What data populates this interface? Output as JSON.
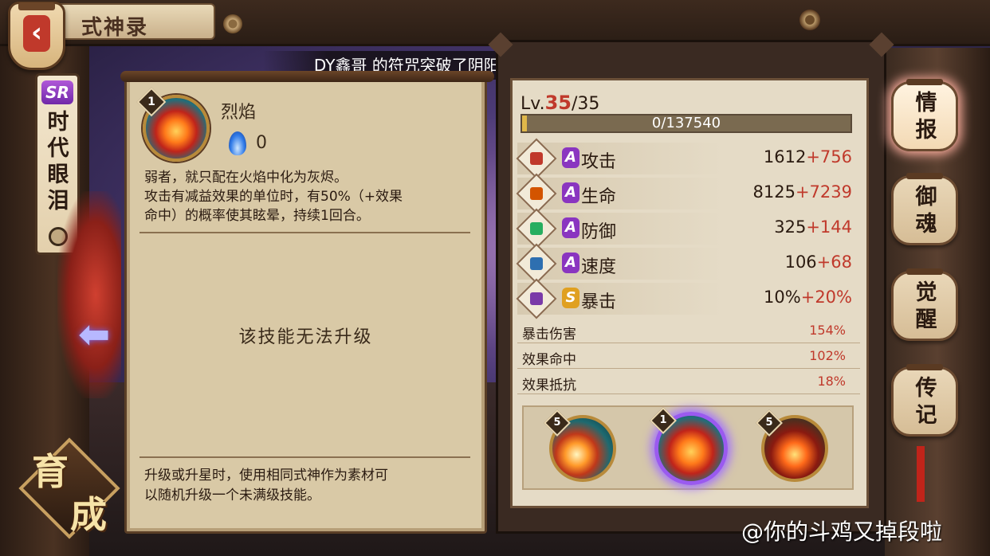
{
  "header": {
    "title": "式神录"
  },
  "announcement": "DY鑫哥 的符咒突破了阴阳两界，召唤出了稀有 SR 式神夜叉！",
  "shikigami": {
    "rarity": "SR",
    "name": "时代眼泪"
  },
  "train_button": {
    "char1": "育",
    "char2": "成"
  },
  "skill": {
    "number": "1",
    "name": "烈焰",
    "cost": "0",
    "description_line1": "弱者，就只配在火焰中化为灰烬。",
    "description_line2": "攻击有减益效果的单位时，有50%（+效果",
    "description_line3": "命中）的概率使其眩晕，持续1回合。",
    "no_upgrade": "该技能无法升级",
    "tip_line1": "升级或升星时，使用相同式神作为素材可",
    "tip_line2": "以随机升级一个未满级技能。"
  },
  "stats": {
    "level_prefix": "Lv.",
    "level_current": "35",
    "level_max": "/35",
    "exp_text": "0/137540",
    "exp_progress": 0.0,
    "rows": [
      {
        "icon": "attack-icon",
        "grade": "A",
        "label": "攻击",
        "base": "1612",
        "bonus": "+756"
      },
      {
        "icon": "health-icon",
        "grade": "A",
        "label": "生命",
        "base": "8125",
        "bonus": "+7239"
      },
      {
        "icon": "defense-icon",
        "grade": "A",
        "label": "防御",
        "base": "325",
        "bonus": "+144"
      },
      {
        "icon": "speed-icon",
        "grade": "A",
        "label": "速度",
        "base": "106",
        "bonus": "+68"
      },
      {
        "icon": "crit-icon",
        "grade": "S",
        "label": "暴击",
        "base": "10%",
        "bonus": "+20%"
      }
    ],
    "sub_rows": [
      {
        "label": "暴击伤害",
        "value": "154%"
      },
      {
        "label": "效果命中",
        "value": "102%"
      },
      {
        "label": "效果抵抗",
        "value": "18%"
      }
    ],
    "skill_slots": [
      {
        "badge": "5",
        "icon": "fireball-icon"
      },
      {
        "badge": "1",
        "icon": "flame-icon"
      },
      {
        "badge": "5",
        "icon": "inferno-icon"
      }
    ]
  },
  "tabs": [
    {
      "label": "情报",
      "active": true
    },
    {
      "label": "御魂",
      "active": false
    },
    {
      "label": "觉醒",
      "active": false
    },
    {
      "label": "传记",
      "active": false
    }
  ],
  "watermark": "@你的斗鸡又掉段啦",
  "colors": {
    "accent_red": "#c0392b",
    "grade_a": "#8a35c0",
    "grade_s": "#e0a020",
    "parchment": "#d9c9a6"
  }
}
